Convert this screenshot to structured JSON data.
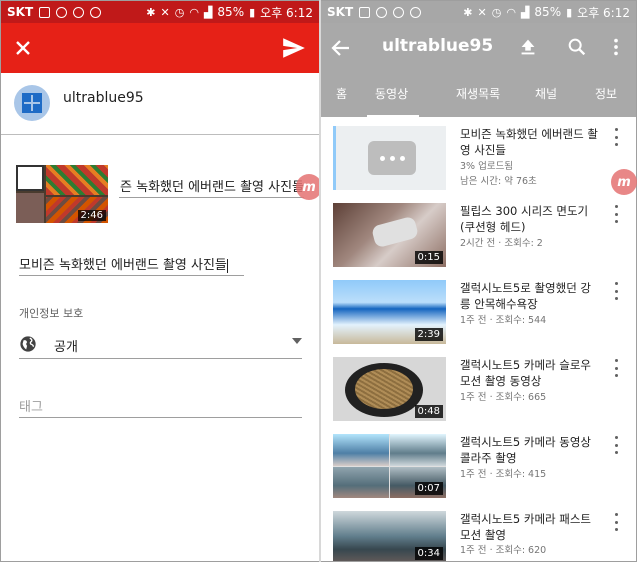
{
  "status_bar": {
    "carrier": "SKT",
    "battery": "85%",
    "time": "오후 6:12"
  },
  "upload_screen": {
    "account_name": "ultrablue95",
    "thumbnail_duration": "2:46",
    "inline_title": "모비즌 녹화했던 에버랜드 촬영 사진들",
    "title_value": "모비즌 녹화했던 에버랜드 촬영 사진들",
    "privacy_label": "개인정보 보호",
    "privacy_value": "공개",
    "tag_placeholder": "태그",
    "accent_color": "#e62117",
    "icons": [
      "close-icon",
      "send-icon",
      "globe-icon",
      "dropdown-arrow-icon"
    ]
  },
  "channel_screen": {
    "title": "ultrablue95",
    "tabs": [
      "홈",
      "동영상",
      "재생목록",
      "채널",
      "정보"
    ],
    "active_tab": "동영상",
    "header_color": "#a9a9a9",
    "icons": [
      "back-arrow-icon",
      "upload-icon",
      "search-icon",
      "more-vert-icon"
    ],
    "videos": [
      {
        "title": "모비즌 녹화했던 에버랜드 촬영 사진들",
        "meta1": "3% 업로드됨",
        "meta2": "남은 시간: 약 76초",
        "duration": ""
      },
      {
        "title": "필립스 300 시리즈 면도기 (쿠션형 헤드)",
        "meta1": "2시간 전 · 조회수: 2",
        "meta2": "",
        "duration": "0:15"
      },
      {
        "title": "갤럭시노트5로 촬영했던 강릉 안목해수욕장",
        "meta1": "1주 전 · 조회수: 544",
        "meta2": "",
        "duration": "2:39"
      },
      {
        "title": "갤럭시노트5 카메라 슬로우 모션 촬영 동영상",
        "meta1": "1주 전 · 조회수: 665",
        "meta2": "",
        "duration": "0:48"
      },
      {
        "title": "갤럭시노트5 카메라 동영상 콜라주 촬영",
        "meta1": "1주 전 · 조회수: 415",
        "meta2": "",
        "duration": "0:07"
      },
      {
        "title": "갤럭시노트5 카메라 패스트 모션 촬영",
        "meta1": "1주 전 · 조회수: 620",
        "meta2": "",
        "duration": "0:34"
      }
    ]
  },
  "overlay_badge_label": "m"
}
